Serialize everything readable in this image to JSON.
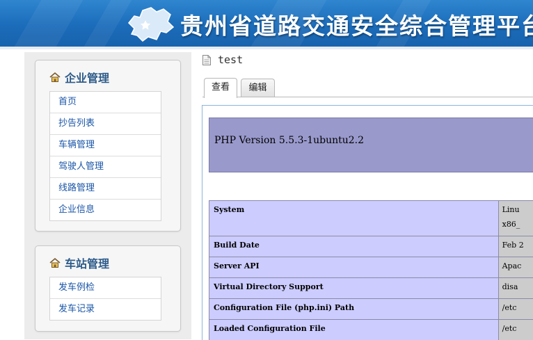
{
  "header": {
    "title": "贵州省道路交通安全综合管理平台"
  },
  "sidebar": {
    "panels": [
      {
        "title": "企业管理",
        "items": [
          "首页",
          "抄告列表",
          "车辆管理",
          "驾驶人管理",
          "线路管理",
          "企业信息"
        ]
      },
      {
        "title": "车站管理",
        "items": [
          "发车例检",
          "发车记录"
        ]
      }
    ]
  },
  "page": {
    "title": "test"
  },
  "tabs": {
    "view": "查看",
    "edit": "编辑"
  },
  "phpinfo": {
    "version": "PHP Version 5.5.3-1ubuntu2.2",
    "rows": [
      {
        "key": "System",
        "value": "Linu",
        "value2": "x86_"
      },
      {
        "key": "Build Date",
        "value": "Feb 2"
      },
      {
        "key": "Server API",
        "value": "Apac"
      },
      {
        "key": "Virtual Directory Support",
        "value": "disa"
      },
      {
        "key": "Configuration File (php.ini) Path",
        "value": "/etc"
      },
      {
        "key": "Loaded Configuration File",
        "value": "/etc"
      }
    ]
  },
  "colors": {
    "banner": "#1b6cba",
    "php_header": "#9999cc",
    "php_key": "#ccccff",
    "php_value": "#cccccc",
    "link": "#1a56a8"
  },
  "icons": {
    "banner": "guizhou-map-icon",
    "panel": "home-icon",
    "page": "document-icon"
  }
}
